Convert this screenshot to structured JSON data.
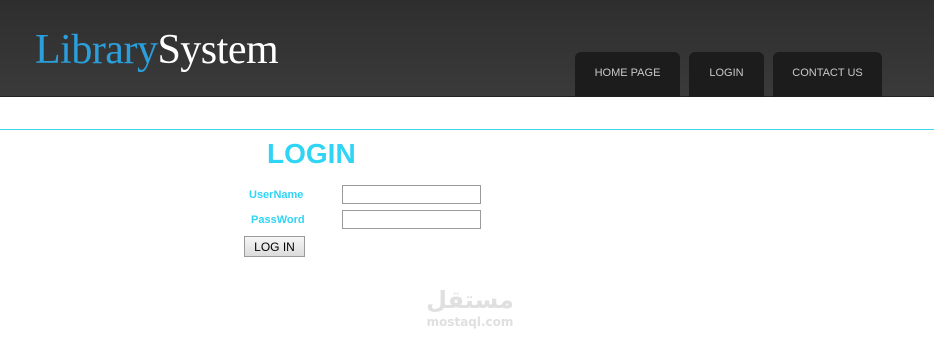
{
  "header": {
    "logo_part1": "Library",
    "logo_part2": "System",
    "nav": [
      {
        "label": "HOME PAGE"
      },
      {
        "label": "LOGIN"
      },
      {
        "label": "CONTACT US"
      }
    ]
  },
  "login": {
    "title": "LOGIN",
    "username_label": "UserName",
    "username_value": "",
    "password_label": "PassWord",
    "password_value": "",
    "submit_label": "LOG IN"
  },
  "watermark": {
    "arabic": "مستقل",
    "domain": "mostaql.com"
  },
  "colors": {
    "header_bg": "#333333",
    "logo_accent": "#2b9fdc",
    "login_accent": "#30d4f5",
    "nav_tab_bg": "#1c1c1c"
  }
}
